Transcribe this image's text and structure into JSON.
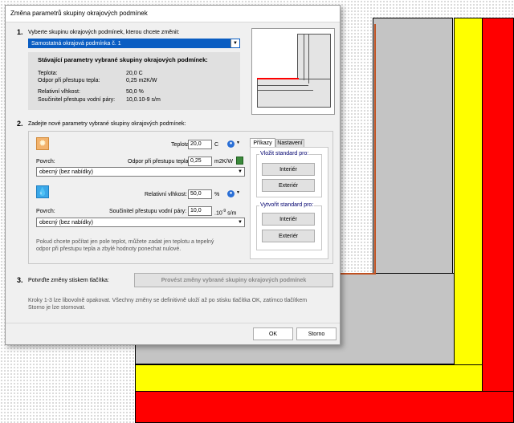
{
  "window": {
    "title": "Změna parametrů skupiny okrajových podmínek"
  },
  "step1": {
    "num": "1.",
    "label": "Vyberte skupinu okrajových podmínek, kterou chcete změnit:",
    "selected": "Samostatná okrajová podmínka č. 1"
  },
  "current": {
    "title": "Stávající parametry vybrané skupiny okrajových podmínek:",
    "rows": [
      {
        "label": "Teplota:",
        "value": "20,0 C"
      },
      {
        "label": "Odpor při přestupu tepla:",
        "value": "0,25 m2K/W"
      },
      {
        "label": "Relativní vlhkost:",
        "value": "50,0 %"
      },
      {
        "label": "Součinitel přestupu vodní páry:",
        "value": "10,0.10-9 s/m"
      }
    ]
  },
  "step2": {
    "num": "2.",
    "label": "Zadejte nové parametry vybrané skupiny okrajových podmínek:"
  },
  "heat": {
    "temp_label": "Teplota:",
    "temp_value": "20,0",
    "temp_unit": "C",
    "surface_label": "Povrch:",
    "resist_label": "Odpor při přestupu tepla:",
    "resist_value": "0,25",
    "resist_unit": "m2K/W",
    "surface_value": "obecný (bez nabídky)"
  },
  "humid": {
    "hum_label": "Relativní vlhkost:",
    "hum_value": "50,0",
    "hum_unit": "%",
    "surface_label": "Povrch:",
    "coef_label": "Součinitel přestupu vodní páry:",
    "coef_value": "10,0",
    "coef_unit_base": ".10",
    "coef_unit_exp": "-9",
    "coef_unit_tail": "s/m",
    "surface_value": "obecný (bez nabídky)"
  },
  "hint": "Pokud chcete počítat jen pole teplot, můžete zadat jen teplotu a tepelný odpor při přestupu tepla a zbylé hodnoty ponechat nulové.",
  "tabs": {
    "commands": "Příkazy",
    "settings": "Nastavení"
  },
  "insert_std": {
    "title": "Vložit standard pro:",
    "interior": "Interiér",
    "exterior": "Exteriér"
  },
  "create_std": {
    "title": "Vytvořit standard pro:",
    "interior": "Interiér",
    "exterior": "Exteriér"
  },
  "step3": {
    "num": "3.",
    "label": "Potvrďte změny stiskem tlačítka:",
    "button": "Provést změny vybrané skupiny okrajových podmínek"
  },
  "footer_note": "Kroky 1-3 lze libovolně opakovat. Všechny změny se definitivně uloží až po stisku tlačítka OK, zatímco tlačítkem Storno je lze stornovat.",
  "ok": "OK",
  "cancel": "Storno",
  "colors": {
    "red": "#ff0000",
    "yellow": "#ffff00",
    "gray": "#c0c0c0",
    "accent": "#0a5dc2"
  }
}
